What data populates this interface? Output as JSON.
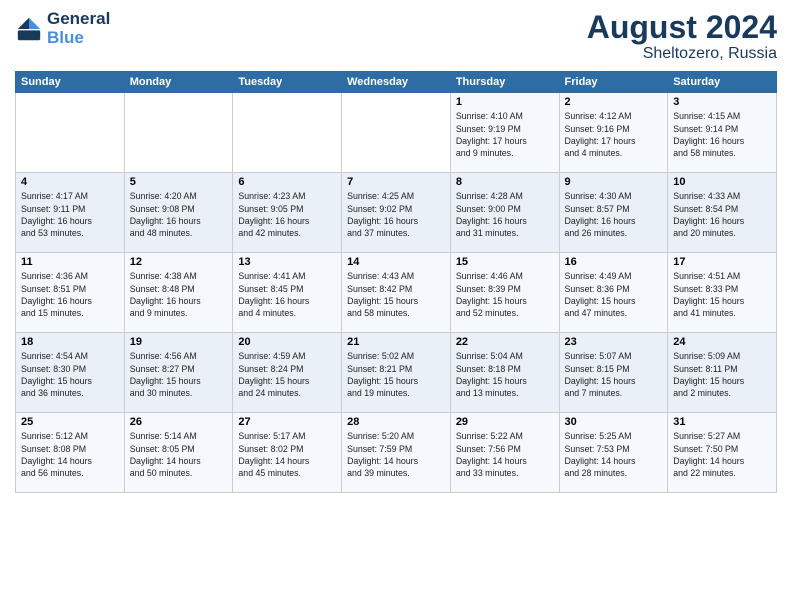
{
  "logo": {
    "text_general": "General",
    "text_blue": "Blue"
  },
  "title": {
    "month_year": "August 2024",
    "location": "Sheltozero, Russia"
  },
  "days_of_week": [
    "Sunday",
    "Monday",
    "Tuesday",
    "Wednesday",
    "Thursday",
    "Friday",
    "Saturday"
  ],
  "weeks": [
    [
      {
        "day": "",
        "info": ""
      },
      {
        "day": "",
        "info": ""
      },
      {
        "day": "",
        "info": ""
      },
      {
        "day": "",
        "info": ""
      },
      {
        "day": "1",
        "info": "Sunrise: 4:10 AM\nSunset: 9:19 PM\nDaylight: 17 hours\nand 9 minutes."
      },
      {
        "day": "2",
        "info": "Sunrise: 4:12 AM\nSunset: 9:16 PM\nDaylight: 17 hours\nand 4 minutes."
      },
      {
        "day": "3",
        "info": "Sunrise: 4:15 AM\nSunset: 9:14 PM\nDaylight: 16 hours\nand 58 minutes."
      }
    ],
    [
      {
        "day": "4",
        "info": "Sunrise: 4:17 AM\nSunset: 9:11 PM\nDaylight: 16 hours\nand 53 minutes."
      },
      {
        "day": "5",
        "info": "Sunrise: 4:20 AM\nSunset: 9:08 PM\nDaylight: 16 hours\nand 48 minutes."
      },
      {
        "day": "6",
        "info": "Sunrise: 4:23 AM\nSunset: 9:05 PM\nDaylight: 16 hours\nand 42 minutes."
      },
      {
        "day": "7",
        "info": "Sunrise: 4:25 AM\nSunset: 9:02 PM\nDaylight: 16 hours\nand 37 minutes."
      },
      {
        "day": "8",
        "info": "Sunrise: 4:28 AM\nSunset: 9:00 PM\nDaylight: 16 hours\nand 31 minutes."
      },
      {
        "day": "9",
        "info": "Sunrise: 4:30 AM\nSunset: 8:57 PM\nDaylight: 16 hours\nand 26 minutes."
      },
      {
        "day": "10",
        "info": "Sunrise: 4:33 AM\nSunset: 8:54 PM\nDaylight: 16 hours\nand 20 minutes."
      }
    ],
    [
      {
        "day": "11",
        "info": "Sunrise: 4:36 AM\nSunset: 8:51 PM\nDaylight: 16 hours\nand 15 minutes."
      },
      {
        "day": "12",
        "info": "Sunrise: 4:38 AM\nSunset: 8:48 PM\nDaylight: 16 hours\nand 9 minutes."
      },
      {
        "day": "13",
        "info": "Sunrise: 4:41 AM\nSunset: 8:45 PM\nDaylight: 16 hours\nand 4 minutes."
      },
      {
        "day": "14",
        "info": "Sunrise: 4:43 AM\nSunset: 8:42 PM\nDaylight: 15 hours\nand 58 minutes."
      },
      {
        "day": "15",
        "info": "Sunrise: 4:46 AM\nSunset: 8:39 PM\nDaylight: 15 hours\nand 52 minutes."
      },
      {
        "day": "16",
        "info": "Sunrise: 4:49 AM\nSunset: 8:36 PM\nDaylight: 15 hours\nand 47 minutes."
      },
      {
        "day": "17",
        "info": "Sunrise: 4:51 AM\nSunset: 8:33 PM\nDaylight: 15 hours\nand 41 minutes."
      }
    ],
    [
      {
        "day": "18",
        "info": "Sunrise: 4:54 AM\nSunset: 8:30 PM\nDaylight: 15 hours\nand 36 minutes."
      },
      {
        "day": "19",
        "info": "Sunrise: 4:56 AM\nSunset: 8:27 PM\nDaylight: 15 hours\nand 30 minutes."
      },
      {
        "day": "20",
        "info": "Sunrise: 4:59 AM\nSunset: 8:24 PM\nDaylight: 15 hours\nand 24 minutes."
      },
      {
        "day": "21",
        "info": "Sunrise: 5:02 AM\nSunset: 8:21 PM\nDaylight: 15 hours\nand 19 minutes."
      },
      {
        "day": "22",
        "info": "Sunrise: 5:04 AM\nSunset: 8:18 PM\nDaylight: 15 hours\nand 13 minutes."
      },
      {
        "day": "23",
        "info": "Sunrise: 5:07 AM\nSunset: 8:15 PM\nDaylight: 15 hours\nand 7 minutes."
      },
      {
        "day": "24",
        "info": "Sunrise: 5:09 AM\nSunset: 8:11 PM\nDaylight: 15 hours\nand 2 minutes."
      }
    ],
    [
      {
        "day": "25",
        "info": "Sunrise: 5:12 AM\nSunset: 8:08 PM\nDaylight: 14 hours\nand 56 minutes."
      },
      {
        "day": "26",
        "info": "Sunrise: 5:14 AM\nSunset: 8:05 PM\nDaylight: 14 hours\nand 50 minutes."
      },
      {
        "day": "27",
        "info": "Sunrise: 5:17 AM\nSunset: 8:02 PM\nDaylight: 14 hours\nand 45 minutes."
      },
      {
        "day": "28",
        "info": "Sunrise: 5:20 AM\nSunset: 7:59 PM\nDaylight: 14 hours\nand 39 minutes."
      },
      {
        "day": "29",
        "info": "Sunrise: 5:22 AM\nSunset: 7:56 PM\nDaylight: 14 hours\nand 33 minutes."
      },
      {
        "day": "30",
        "info": "Sunrise: 5:25 AM\nSunset: 7:53 PM\nDaylight: 14 hours\nand 28 minutes."
      },
      {
        "day": "31",
        "info": "Sunrise: 5:27 AM\nSunset: 7:50 PM\nDaylight: 14 hours\nand 22 minutes."
      }
    ]
  ]
}
